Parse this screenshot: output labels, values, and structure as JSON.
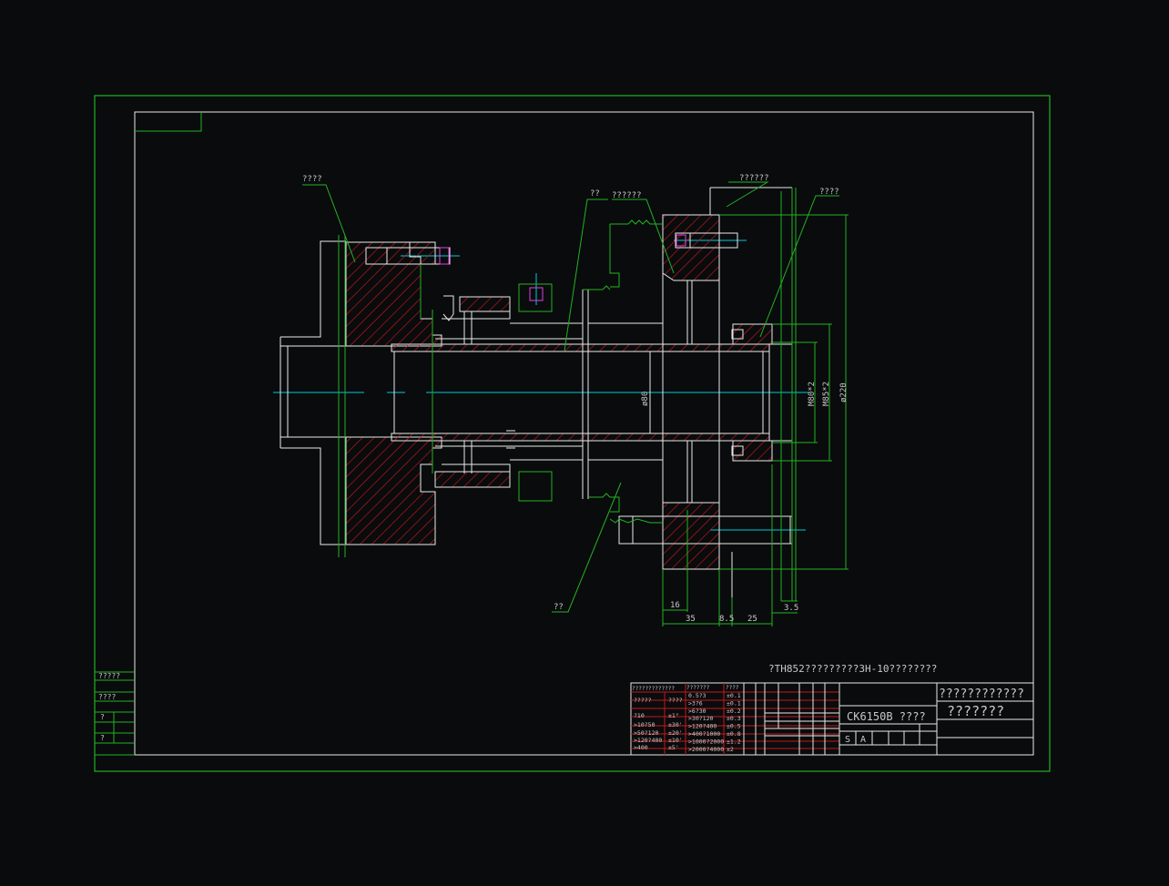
{
  "callouts": {
    "flange": "????",
    "shaft": "??",
    "sleeve": "??????",
    "bolt_group": "??????",
    "nut": "????",
    "lower": "??"
  },
  "dimensions": {
    "bore": "ø80",
    "thread1": "M80*2",
    "thread2": "M85*2",
    "outer": "ø220",
    "d16": "16",
    "d35": "35",
    "d85": "8.5",
    "d25": "25",
    "d35b": "3.5"
  },
  "note": "?TH852?????????3H-10????????",
  "title_block": {
    "drawing_name": "????????????",
    "drawing_name2": "???????",
    "model": "CK6150B  ????",
    "scale_s": "S",
    "scale_a": "A"
  },
  "tolerance_table": {
    "header_left": "?????????????",
    "header_mid": "???????",
    "header_right": "????",
    "rows_left": [
      [
        "?????",
        "????"
      ],
      [
        "?10",
        "±1°"
      ],
      [
        ">10?50",
        "±30'"
      ],
      [
        ">50?120",
        "±20'"
      ],
      [
        ">120?400",
        "±10'"
      ],
      [
        ">400",
        "±5'"
      ]
    ],
    "rows_right": [
      [
        "0.5?3",
        "±0.1"
      ],
      [
        ">3?6",
        "±0.1"
      ],
      [
        ">6?30",
        "±0.2"
      ],
      [
        ">30?120",
        "±0.3"
      ],
      [
        ">120?400",
        "±0.5"
      ],
      [
        ">400?1000",
        "±0.8"
      ],
      [
        ">1000?2000",
        "±1.2"
      ],
      [
        ">2000?4000",
        "±2"
      ]
    ]
  },
  "left_strip": {
    "r1": "?????",
    "r2": "????",
    "r3": "?",
    "r4": "?"
  },
  "colors": {
    "background": "#0a0b0d",
    "border": "#22b322",
    "outline": "#e8e8e8",
    "hatch": "#c21a1a",
    "centerline": "#00c8d8",
    "magenta": "#e040e0"
  }
}
